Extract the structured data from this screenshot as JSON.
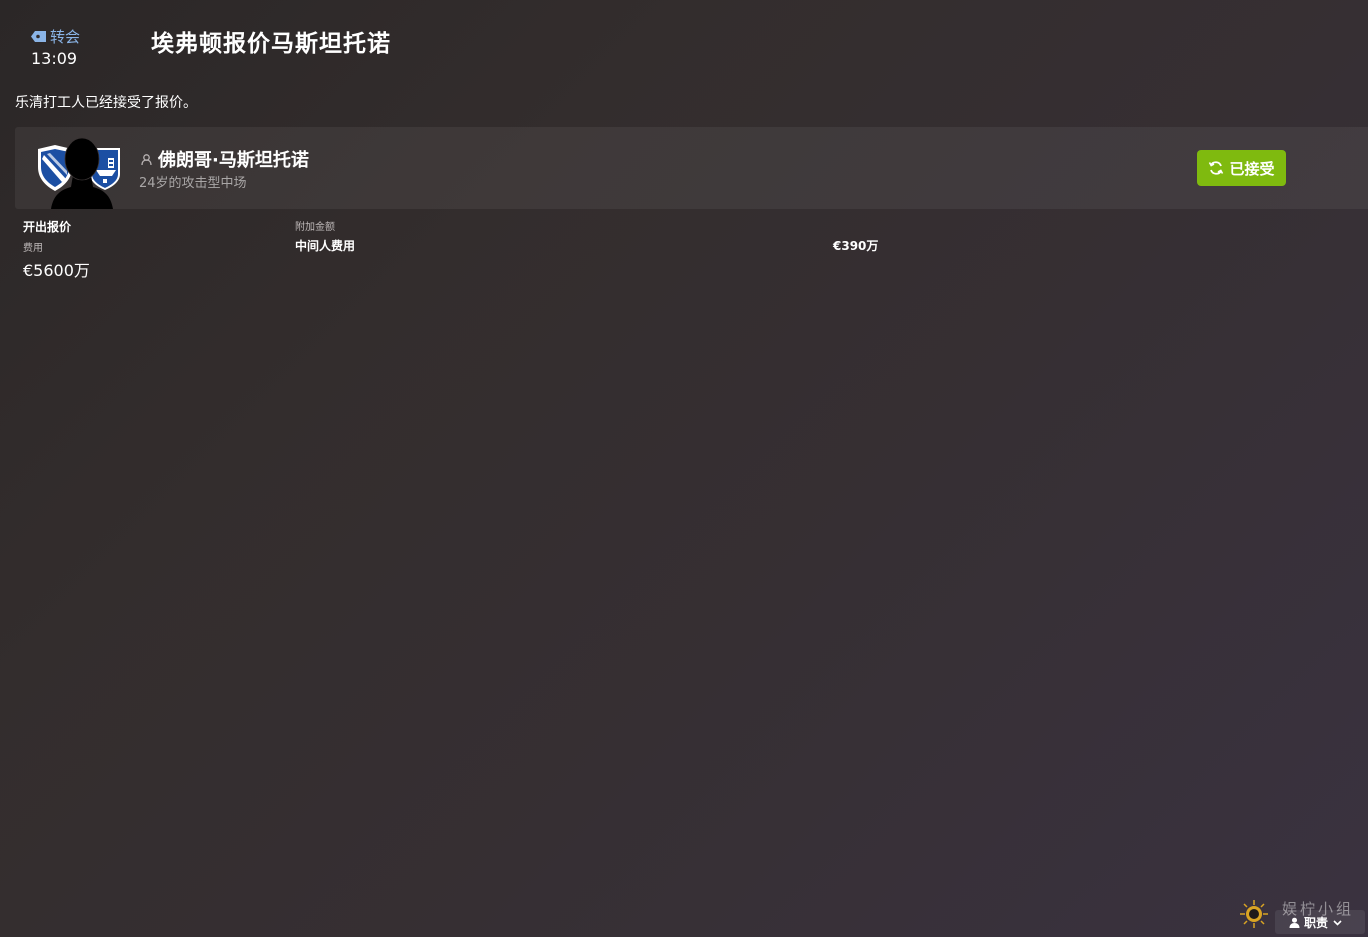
{
  "header": {
    "category_label": "转会",
    "time": "13:09",
    "title": "埃弗顿报价马斯坦托诺"
  },
  "message": "乐清打工人已经接受了报价。",
  "player": {
    "name": "佛朗哥·马斯坦托诺",
    "description": "24岁的攻击型中场",
    "status_button_label": "已接受",
    "status_color": "#7fba0f"
  },
  "offer": {
    "section_label": "开出报价",
    "fee_label": "费用",
    "fee_value": "€5600万",
    "extra_label": "附加金额",
    "agent_fee_label": "中间人费用",
    "agent_fee_value": "€390万"
  },
  "footer": {
    "duties_label": "职责",
    "watermark_text": "娱柠小组"
  },
  "colors": {
    "accent_blue": "#8ab4e6",
    "accept_green": "#7fba0f",
    "club_blue": "#1c4fa3"
  },
  "icons": {
    "category": "tag-icon",
    "player": "person-icon",
    "button": "refresh-icon",
    "footer": "person-icon"
  }
}
